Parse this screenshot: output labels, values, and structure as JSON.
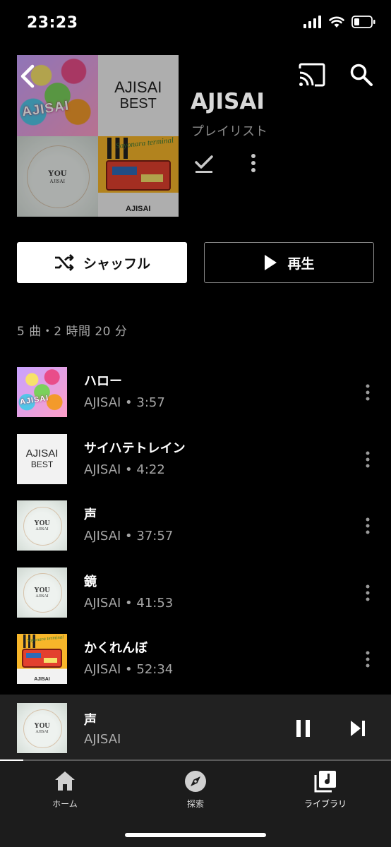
{
  "status_bar": {
    "time": "23:23"
  },
  "playlist": {
    "title": "AJISAI",
    "subtitle": "プレイリスト",
    "cover": {
      "flower_text": "AJISAI",
      "best_line1": "AJISAI",
      "best_line2": "BEST",
      "you_line1": "YOU",
      "you_line2": "AJISAI",
      "suitcase_logo": "AJISAI",
      "suitcase_swirl": "Sayonara terminal"
    }
  },
  "buttons": {
    "shuffle": "シャッフル",
    "play": "再生"
  },
  "summary": "5 曲・2 時間 20 分",
  "tracks": [
    {
      "title": "ハロー",
      "meta": "AJISAI • 3:57",
      "art": "flower"
    },
    {
      "title": "サイハテトレイン",
      "meta": "AJISAI • 4:22",
      "art": "best"
    },
    {
      "title": "声",
      "meta": "AJISAI • 37:57",
      "art": "you"
    },
    {
      "title": "鏡",
      "meta": "AJISAI • 41:53",
      "art": "you"
    },
    {
      "title": "かくれんぼ",
      "meta": "AJISAI • 52:34",
      "art": "suitcase"
    }
  ],
  "now_playing": {
    "title": "声",
    "artist": "AJISAI",
    "progress": 0.06
  },
  "nav": {
    "home": "ホーム",
    "explore": "探索",
    "library": "ライブラリ"
  },
  "icons": [
    "signal-icon",
    "wifi-icon",
    "battery-icon",
    "back-icon",
    "cast-icon",
    "search-icon",
    "check-icon",
    "more-icon",
    "shuffle-icon",
    "play-icon",
    "pause-icon",
    "next-icon",
    "home-icon",
    "compass-icon",
    "library-icon"
  ]
}
